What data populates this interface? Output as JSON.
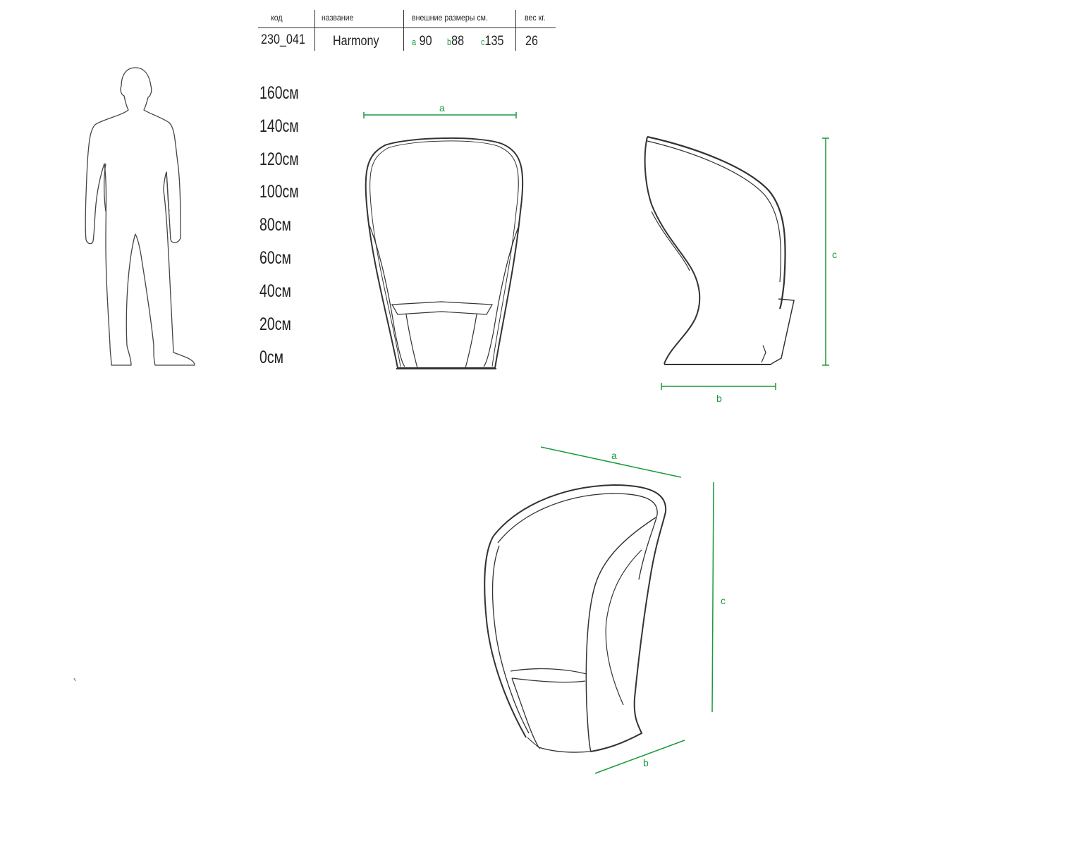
{
  "spec_table": {
    "headers": {
      "code": "код",
      "name": "название",
      "dimensions": "внешние размеры см.",
      "weight": "вес кг."
    },
    "code": "230_041",
    "name": "Harmony",
    "dimensions": [
      {
        "key": "a",
        "value": "90"
      },
      {
        "key": "b",
        "value": "88"
      },
      {
        "key": "c",
        "value": "135"
      }
    ],
    "weight": "26"
  },
  "height_scale": [
    "160см",
    "140см",
    "120см",
    "100см",
    "80см",
    "60см",
    "40см",
    "20см",
    "0см"
  ],
  "dimension_labels": {
    "front_width": "a",
    "side_depth": "b",
    "side_height": "c",
    "iso_width": "a",
    "iso_height": "c",
    "iso_depth": "b"
  },
  "colors": {
    "accent_green": "#1a9a3a",
    "line": "#333333"
  }
}
